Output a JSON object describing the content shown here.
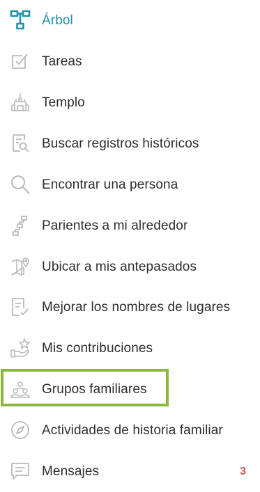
{
  "colors": {
    "accent": "#1f8fb0",
    "icon_gray": "#b9b9b9",
    "text": "#2d2d2d",
    "badge": "#d9534f",
    "highlight": "#8db63f"
  },
  "menu": {
    "items": [
      {
        "label": "Árbol",
        "icon": "tree-icon",
        "active": true
      },
      {
        "label": "Tareas",
        "icon": "tasks-checklist-icon"
      },
      {
        "label": "Templo",
        "icon": "temple-icon"
      },
      {
        "label": "Buscar registros históricos",
        "icon": "search-records-icon"
      },
      {
        "label": "Encontrar una persona",
        "icon": "search-icon"
      },
      {
        "label": "Parientes a mi alrededor",
        "icon": "relatives-around-icon"
      },
      {
        "label": "Ubicar a mis antepasados",
        "icon": "map-pin-icon"
      },
      {
        "label": "Mejorar los nombres de lugares",
        "icon": "document-check-icon"
      },
      {
        "label": "Mis contribuciones",
        "icon": "contributions-star-icon"
      },
      {
        "label": "Grupos familiares",
        "icon": "family-groups-icon",
        "highlighted": true
      },
      {
        "label": "Actividades de historia familiar",
        "icon": "compass-icon"
      },
      {
        "label": "Mensajes",
        "icon": "messages-icon",
        "badge": "3"
      }
    ]
  }
}
